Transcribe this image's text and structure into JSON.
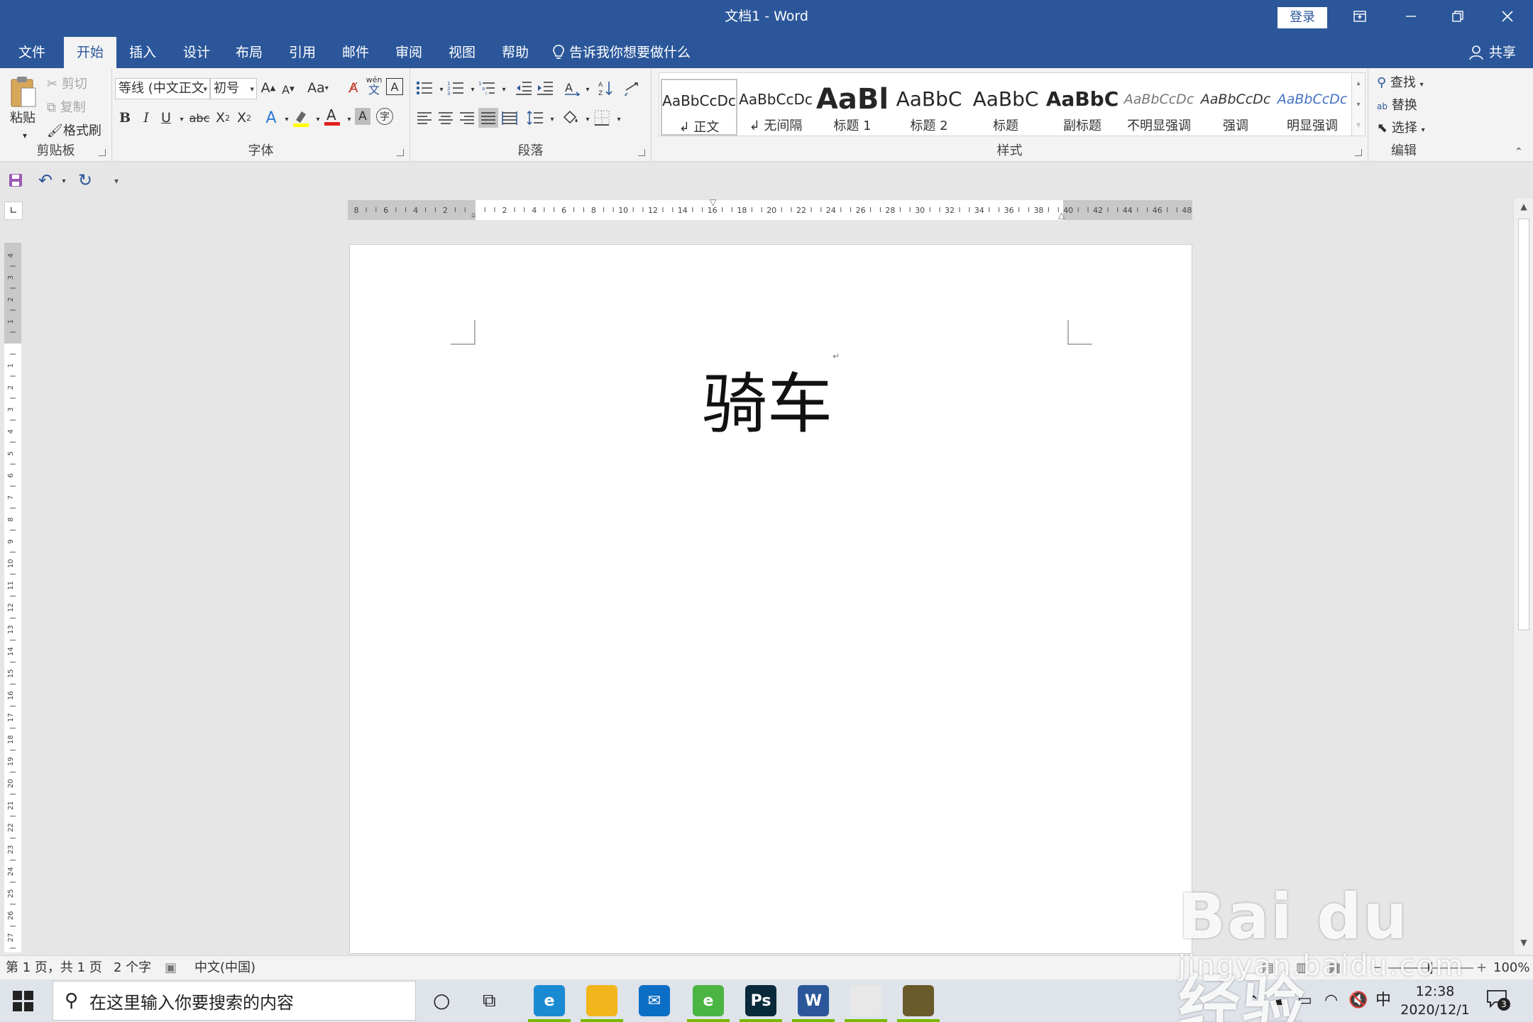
{
  "window": {
    "title": "文档1  -  Word",
    "login_label": "登录",
    "ribbon_display_icon": "ribbon-display-icon",
    "minimize_icon": "minimize-icon",
    "restore_icon": "restore-icon",
    "close_icon": "close-icon"
  },
  "tabs": [
    {
      "label": "文件",
      "active": false
    },
    {
      "label": "开始",
      "active": true
    },
    {
      "label": "插入",
      "active": false
    },
    {
      "label": "设计",
      "active": false
    },
    {
      "label": "布局",
      "active": false
    },
    {
      "label": "引用",
      "active": false
    },
    {
      "label": "邮件",
      "active": false
    },
    {
      "label": "审阅",
      "active": false
    },
    {
      "label": "视图",
      "active": false
    },
    {
      "label": "帮助",
      "active": false
    }
  ],
  "tellme": "告诉我你想要做什么",
  "share": "共享",
  "clipboard": {
    "paste": "粘贴",
    "cut": "剪切",
    "copy": "复制",
    "format_painter": "格式刷",
    "label": "剪贴板"
  },
  "font": {
    "font_name": "等线 (中文正文",
    "font_size": "初号",
    "change_case": "Aa",
    "phonetic_top": "wén",
    "phonetic_bottom": "文",
    "bold": "B",
    "italic": "I",
    "underline": "U",
    "strikethrough": "abc",
    "subscript": "X",
    "superscript": "X",
    "label": "字体"
  },
  "paragraph": {
    "label": "段落"
  },
  "styles": {
    "items": [
      {
        "preview": "AaBbCcDc",
        "name": "↲ 正文",
        "selected": true
      },
      {
        "preview": "AaBbCcDc",
        "name": "↲ 无间隔",
        "selected": false
      },
      {
        "preview": "AaBl",
        "name": "标题 1",
        "selected": false
      },
      {
        "preview": "AaBbC",
        "name": "标题 2",
        "selected": false
      },
      {
        "preview": "AaBbC",
        "name": "标题",
        "selected": false
      },
      {
        "preview": "AaBbC",
        "name": "副标题",
        "selected": false
      },
      {
        "preview": "AaBbCcDc",
        "name": "不明显强调",
        "selected": false
      },
      {
        "preview": "AaBbCcDc",
        "name": "强调",
        "selected": false
      },
      {
        "preview": "AaBbCcDc",
        "name": "明显强调",
        "selected": false
      }
    ],
    "label": "样式"
  },
  "editing": {
    "find": "查找",
    "replace": "替换",
    "select": "选择",
    "label": "编辑"
  },
  "ruler": {
    "h_labels": [
      "8",
      "6",
      "4",
      "2",
      "",
      "2",
      "4",
      "6",
      "8",
      "10",
      "12",
      "14",
      "16",
      "18",
      "20",
      "22",
      "24",
      "26",
      "28",
      "30",
      "32",
      "34",
      "36",
      "38",
      "40",
      "42",
      "44",
      "46",
      "48"
    ],
    "v_labels": [
      "4",
      "3",
      "2",
      "1",
      "",
      "1",
      "2",
      "3",
      "4",
      "5",
      "6",
      "7",
      "8",
      "9",
      "10",
      "11",
      "12",
      "13",
      "14",
      "15",
      "16",
      "17",
      "18",
      "19",
      "20",
      "21",
      "22",
      "23",
      "24",
      "25",
      "26",
      "27"
    ]
  },
  "document": {
    "text": "骑车"
  },
  "statusbar": {
    "page": "第 1 页，共 1 页",
    "words": "2 个字",
    "language": "中文(中国)",
    "zoom": "100%"
  },
  "taskbar": {
    "search_placeholder": "在这里输入你要搜索的内容",
    "apps": [
      {
        "name": "edge-icon",
        "color": "#1a8ad2",
        "label": "e"
      },
      {
        "name": "file-explorer-icon",
        "color": "#f2b51c",
        "label": ""
      },
      {
        "name": "mail-icon",
        "color": "#0b6fc5",
        "label": "✉"
      },
      {
        "name": "ie-browser-icon",
        "color": "#4bb543",
        "label": "e"
      },
      {
        "name": "photoshop-icon",
        "color": "#082a3a",
        "label": "Ps"
      },
      {
        "name": "word-icon",
        "color": "#2b579a",
        "label": "W"
      },
      {
        "name": "qq-penguin-icon",
        "color": "#e8e8e8",
        "label": ""
      },
      {
        "name": "game-icon",
        "color": "#6b5a2a",
        "label": ""
      }
    ],
    "ime": "中",
    "time": "12:38",
    "date": "2020/12/1",
    "notification_count": "3"
  },
  "watermark": {
    "brand": "Bai du 经验",
    "url": "jingyan.baidu.com"
  }
}
